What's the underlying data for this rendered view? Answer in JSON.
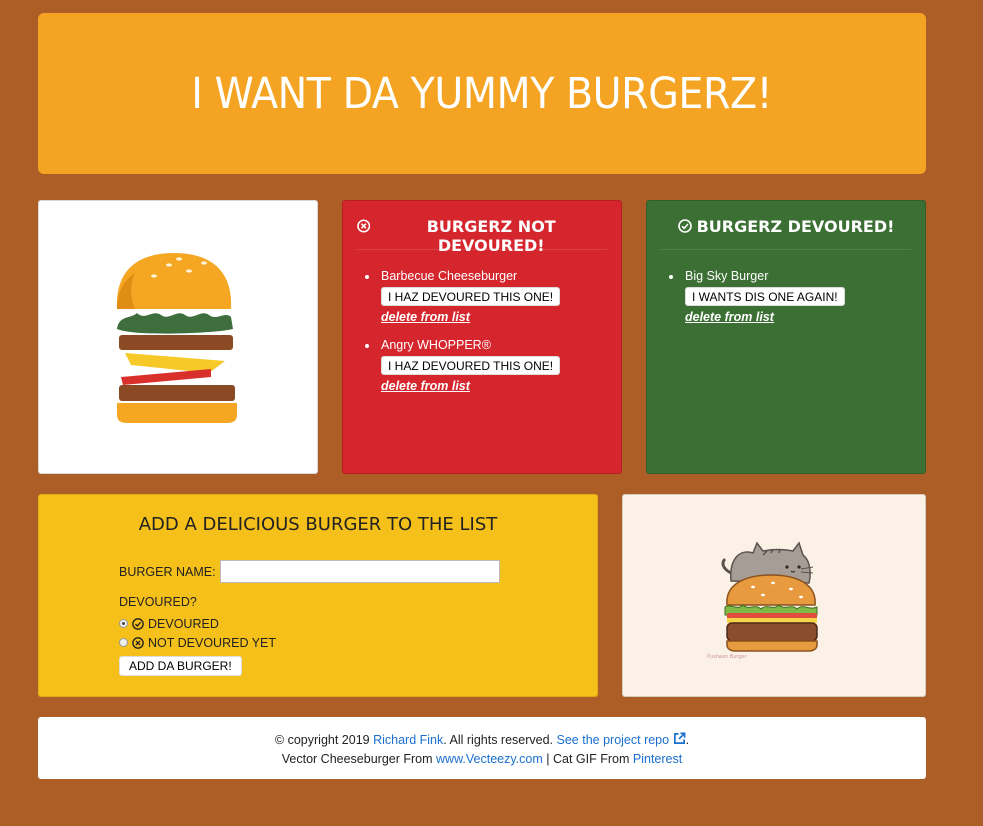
{
  "header": {
    "title": "I WANT DA YUMMY BURGERZ!"
  },
  "not_devoured": {
    "title": "BURGERZ NOT DEVOURED!",
    "items": [
      {
        "name": "Barbecue Cheeseburger",
        "button": "I HAZ DEVOURED THIS ONE!",
        "delete": "delete from list"
      },
      {
        "name": "Angry WHOPPER®",
        "button": "I HAZ DEVOURED THIS ONE!",
        "delete": "delete from list"
      }
    ]
  },
  "devoured": {
    "title": "BURGERZ DEVOURED!",
    "items": [
      {
        "name": "Big Sky Burger",
        "button": "I WANTS DIS ONE AGAIN!",
        "delete": "delete from list"
      }
    ]
  },
  "add_form": {
    "title": "ADD A DELICIOUS BURGER TO THE LIST",
    "name_label": "BURGER NAME:",
    "name_value": "",
    "devoured_label": "DEVOURED?",
    "option_devoured": "DEVOURED",
    "option_not_devoured": "NOT DEVOURED YET",
    "submit": "ADD DA BURGER!"
  },
  "cat_caption": "Pusheen Burger",
  "footer": {
    "copyright": "© copyright 2019",
    "author": "Richard Fink",
    "rights": ". All rights reserved.",
    "repo": "See the project repo",
    "period": ".",
    "vector_prefix": "Vector Cheeseburger From",
    "vector_link": "www.Vecteezy.com",
    "cat_prefix": "| Cat GIF From",
    "cat_link": "Pinterest"
  },
  "colors": {
    "background": "#ad5e26",
    "header": "#f4a422",
    "not_devoured": "#d5262d",
    "devoured": "#3b6f33",
    "form": "#f6c01a",
    "link": "#1a6fd1"
  }
}
